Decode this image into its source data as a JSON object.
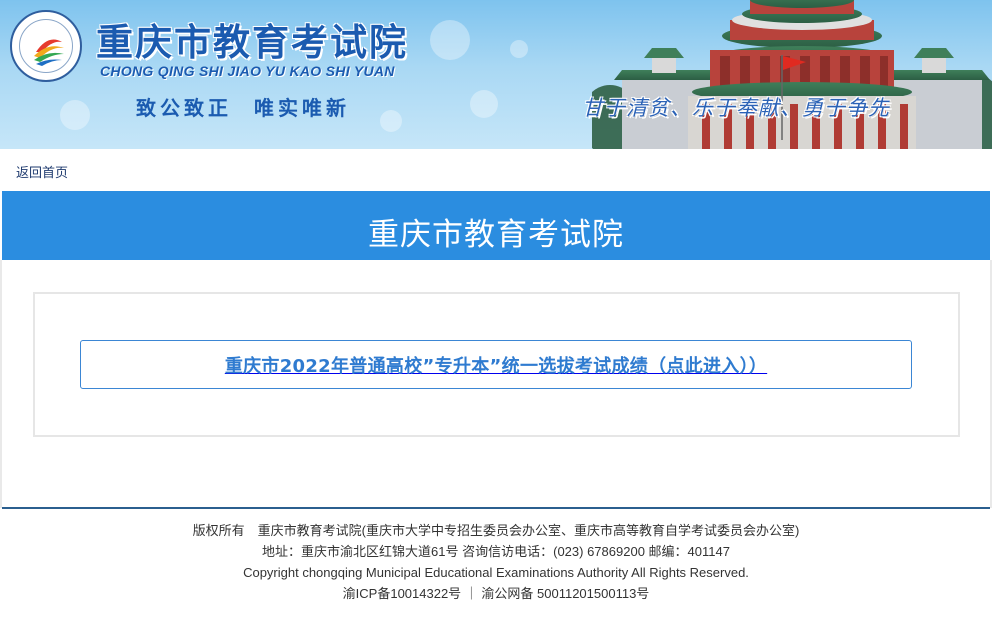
{
  "banner": {
    "title_cn": "重庆市教育考试院",
    "title_en": "CHONG QING SHI JIAO YU KAO SHI YUAN",
    "motto_left_1": "致公致正",
    "motto_left_2": "唯实唯新",
    "motto_right": "甘于清贫、乐于奉献、勇于争先",
    "logo_ring_text": "Chongqing Education Examinations Authority",
    "logo_inner_text": "重庆市教育考试院",
    "colors": {
      "title": "#1b5bb0",
      "sky": "#8ccbf1"
    }
  },
  "breadcrumb": {
    "home_link": "返回首页"
  },
  "page_title": "重庆市教育考试院",
  "main": {
    "result_link_label": "重庆市2022年普通高校”专升本”统一选拔考试成绩（点此进入））",
    "colors": {
      "accent": "#2b8de0",
      "link_text": "#2f7bd0",
      "link_border": "#3b86d4"
    }
  },
  "footer": {
    "line1": "版权所有　重庆市教育考试院(重庆市大学中专招生委员会办公室、重庆市高等教育自学考试委员会办公室)",
    "line2": "地址：重庆市渝北区红锦大道61号 咨询信访电话：(023) 67869200 邮编：401147",
    "line3": "Copyright chongqing Municipal Educational Examinations Authority All Rights Reserved.",
    "line4": "渝ICP备10014322号 ｜ 渝公网备 50011201500113号"
  }
}
